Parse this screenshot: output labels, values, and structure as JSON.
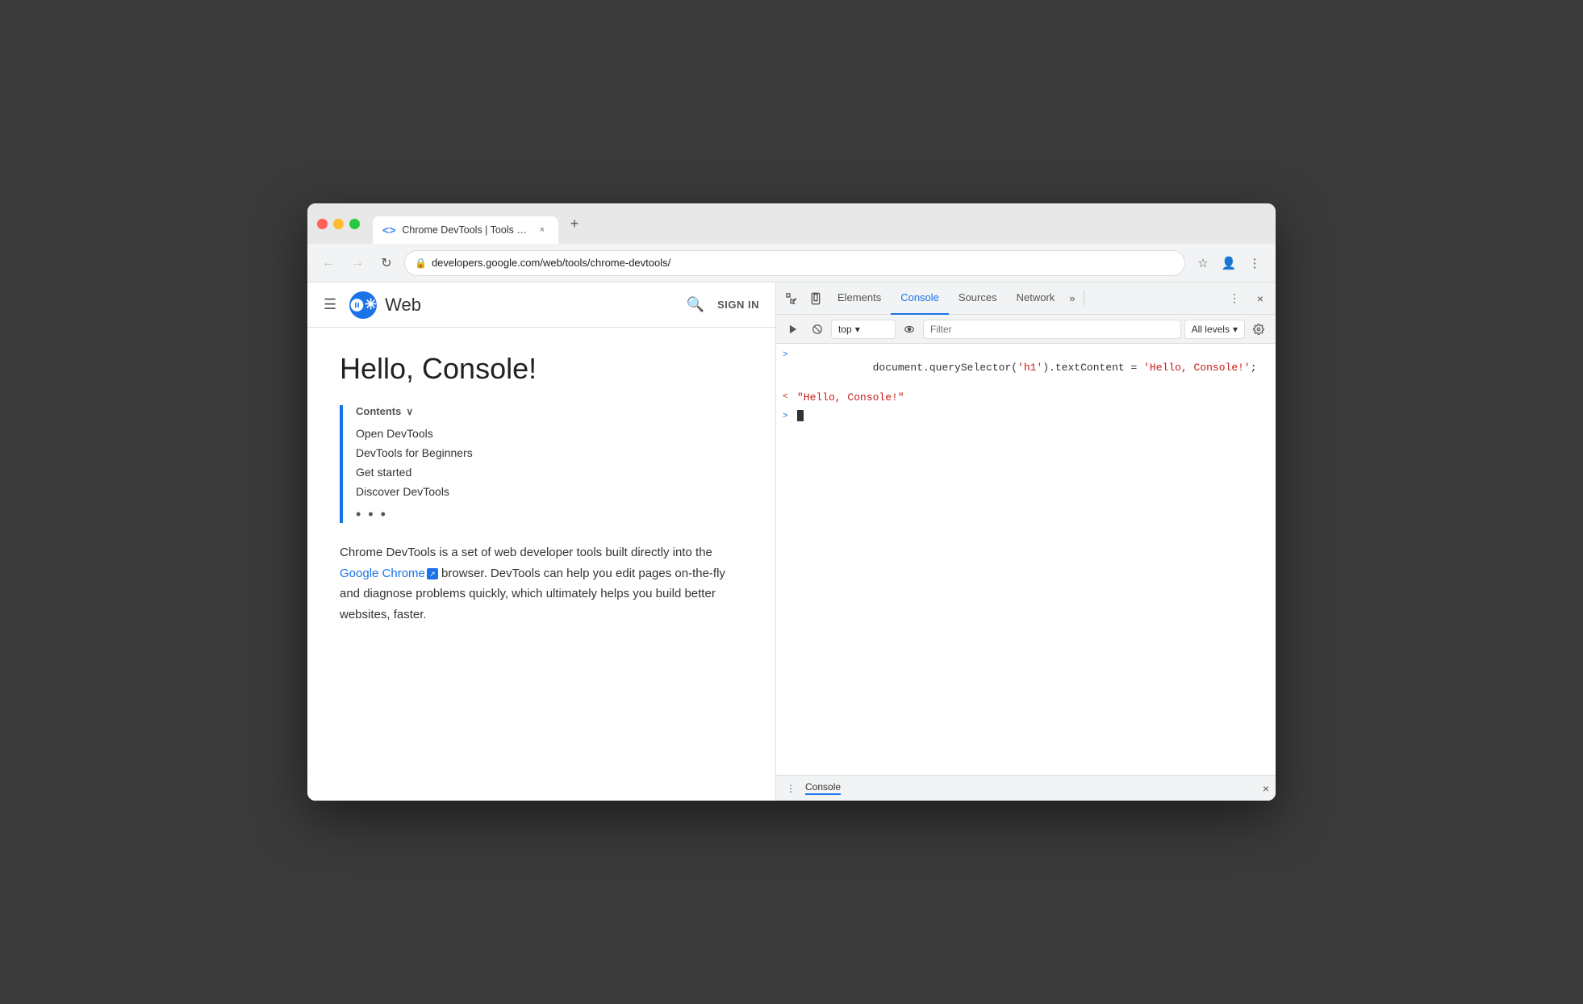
{
  "browser": {
    "traffic_lights": [
      "red",
      "yellow",
      "green"
    ],
    "tab": {
      "icon": "<>",
      "title": "Chrome DevTools | Tools for W",
      "close_label": "×"
    },
    "new_tab_label": "+",
    "address": {
      "url": "developers.google.com/web/tools/chrome-devtools/",
      "lock_icon": "🔒"
    },
    "nav": {
      "back_label": "←",
      "forward_label": "→",
      "refresh_label": "↻"
    },
    "toolbar_icons": [
      "☆",
      "👤",
      "⋮"
    ]
  },
  "page": {
    "site_header": {
      "hamburger_label": "☰",
      "logo_icon": "✳",
      "site_name": "Web",
      "search_icon": "🔍",
      "sign_in_label": "SIGN IN"
    },
    "article": {
      "title": "Hello, Console!",
      "toc": {
        "header": "Contents",
        "chevron": "∨",
        "items": [
          "Open DevTools",
          "DevTools for Beginners",
          "Get started",
          "Discover DevTools"
        ],
        "dots": "• • •"
      },
      "body_start": "Chrome DevTools is a set of web developer tools built directly into the ",
      "link_text": "Google Chrome",
      "external_icon": "↗",
      "body_end": " browser. DevTools can help you edit pages on-the-fly and diagnose problems quickly, which ultimately helps you build better websites, faster."
    }
  },
  "devtools": {
    "tabs": [
      {
        "label": "Elements",
        "active": false
      },
      {
        "label": "Console",
        "active": true
      },
      {
        "label": "Sources",
        "active": false
      },
      {
        "label": "Network",
        "active": false
      }
    ],
    "more_tabs": "»",
    "action_icons": [
      "⋮",
      "×"
    ],
    "toolbar": {
      "play_icon": "▶",
      "stop_icon": "⊘",
      "context_label": "top",
      "context_arrow": "▾",
      "eye_icon": "●",
      "filter_placeholder": "Filter",
      "levels_label": "All levels",
      "levels_arrow": "▾",
      "settings_icon": "⚙"
    },
    "console": {
      "lines": [
        {
          "arrow": ">",
          "type": "input",
          "code": "document.querySelector('h1').textContent = ",
          "string": "'Hello, Console!'",
          "suffix": ";"
        },
        {
          "arrow": "<",
          "type": "output",
          "string": "\"Hello, Console!\""
        }
      ],
      "cursor_line": {
        "arrow": ">",
        "cursor": "|"
      }
    },
    "bottom_bar": {
      "dots_icon": "⋮",
      "label": "Console",
      "close_icon": "×"
    }
  }
}
